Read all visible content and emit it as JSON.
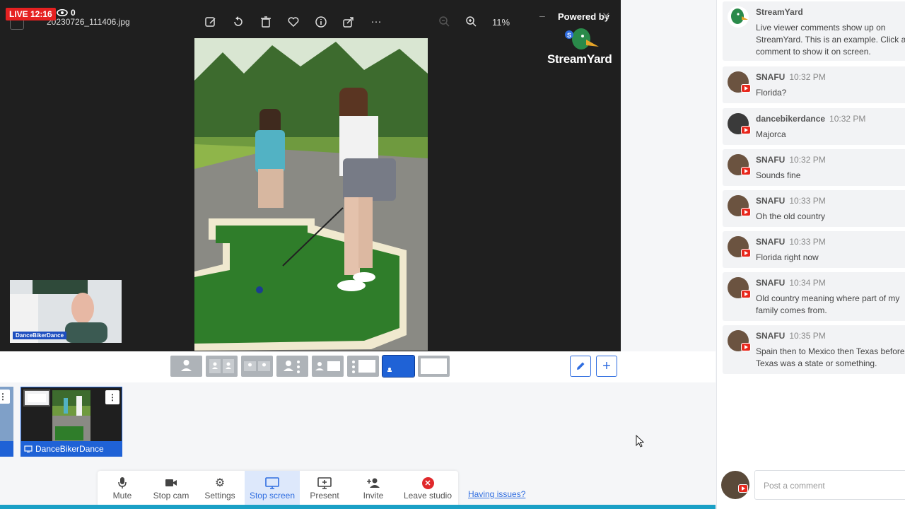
{
  "live": {
    "label": "LIVE 12:16",
    "viewers": "0"
  },
  "viewer": {
    "filename": "20230726_111406.jpg",
    "zoom": "11%",
    "powered_by": "Powered by",
    "brand": "StreamYard"
  },
  "camera": {
    "name": "DanceBikerDance"
  },
  "tile": {
    "name": "DanceBikerDance"
  },
  "controls": [
    {
      "label": "Mute",
      "icon": "microphone-icon"
    },
    {
      "label": "Stop cam",
      "icon": "camera-icon"
    },
    {
      "label": "Settings",
      "icon": "gear-icon"
    },
    {
      "label": "Stop screen",
      "icon": "monitor-icon"
    },
    {
      "label": "Present",
      "icon": "present-icon"
    },
    {
      "label": "Invite",
      "icon": "add-person-icon"
    },
    {
      "label": "Leave studio",
      "icon": "close-circle-icon"
    }
  ],
  "having_issues": "Having issues?",
  "comments": [
    {
      "name": "StreamYard",
      "time": "",
      "text": "Live viewer comments show up on StreamYard. This is an example. Click a comment to show it on screen."
    },
    {
      "name": "SNAFU",
      "time": "10:32 PM",
      "text": "Florida?"
    },
    {
      "name": "dancebikerdance",
      "time": "10:32 PM",
      "text": "Majorca"
    },
    {
      "name": "SNAFU",
      "time": "10:32 PM",
      "text": "Sounds fine"
    },
    {
      "name": "SNAFU",
      "time": "10:33 PM",
      "text": "Oh the old country"
    },
    {
      "name": "SNAFU",
      "time": "10:33 PM",
      "text": "Florida right now"
    },
    {
      "name": "SNAFU",
      "time": "10:34 PM",
      "text": "Old country meaning where part of my family comes from."
    },
    {
      "name": "SNAFU",
      "time": "10:35 PM",
      "text": "Spain then to Mexico then Texas before Texas was a state or something."
    }
  ],
  "comment_input": {
    "placeholder": "Post a comment"
  },
  "colors": {
    "live": "#e52121",
    "accent": "#1f62d6",
    "youtube": "#e8281d",
    "leave": "#e0292c"
  }
}
